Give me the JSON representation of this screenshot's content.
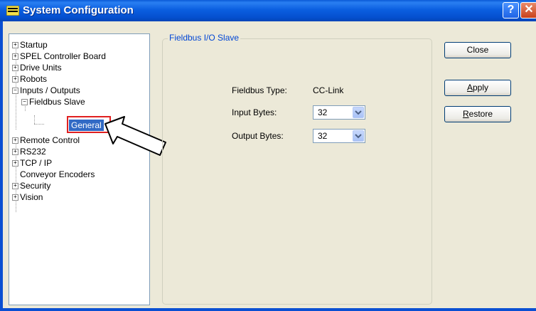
{
  "window": {
    "title": "System Configuration",
    "help_label": "?",
    "close_label": "✕"
  },
  "tree": {
    "items": [
      {
        "label": "Startup",
        "expander": "+"
      },
      {
        "label": "SPEL Controller Board",
        "expander": "+"
      },
      {
        "label": "Drive Units",
        "expander": "+"
      },
      {
        "label": "Robots",
        "expander": "+"
      },
      {
        "label": "Inputs / Outputs",
        "expander": "−"
      },
      {
        "label": "Fieldbus Slave",
        "expander": "−"
      },
      {
        "label": "General",
        "selected": true
      },
      {
        "label": "Remote Control",
        "expander": "+"
      },
      {
        "label": "RS232",
        "expander": "+"
      },
      {
        "label": "TCP / IP",
        "expander": "+"
      },
      {
        "label": "Conveyor Encoders"
      },
      {
        "label": "Security",
        "expander": "+"
      },
      {
        "label": "Vision",
        "expander": "+"
      }
    ]
  },
  "group": {
    "title": "Fieldbus I/O Slave",
    "fieldbus_type_label": "Fieldbus Type:",
    "fieldbus_type_value": "CC-Link",
    "input_bytes_label": "Input Bytes:",
    "input_bytes_value": "32",
    "output_bytes_label": "Output Bytes:",
    "output_bytes_value": "32"
  },
  "buttons": {
    "close": "Close",
    "apply_mnemonic": "A",
    "apply_rest": "pply",
    "restore_mnemonic": "R",
    "restore_rest": "estore"
  },
  "colors": {
    "titlebar": "#0b5fe0",
    "selection": "#316ac5",
    "highlight": "#e02020",
    "group_title": "#0046d5"
  }
}
